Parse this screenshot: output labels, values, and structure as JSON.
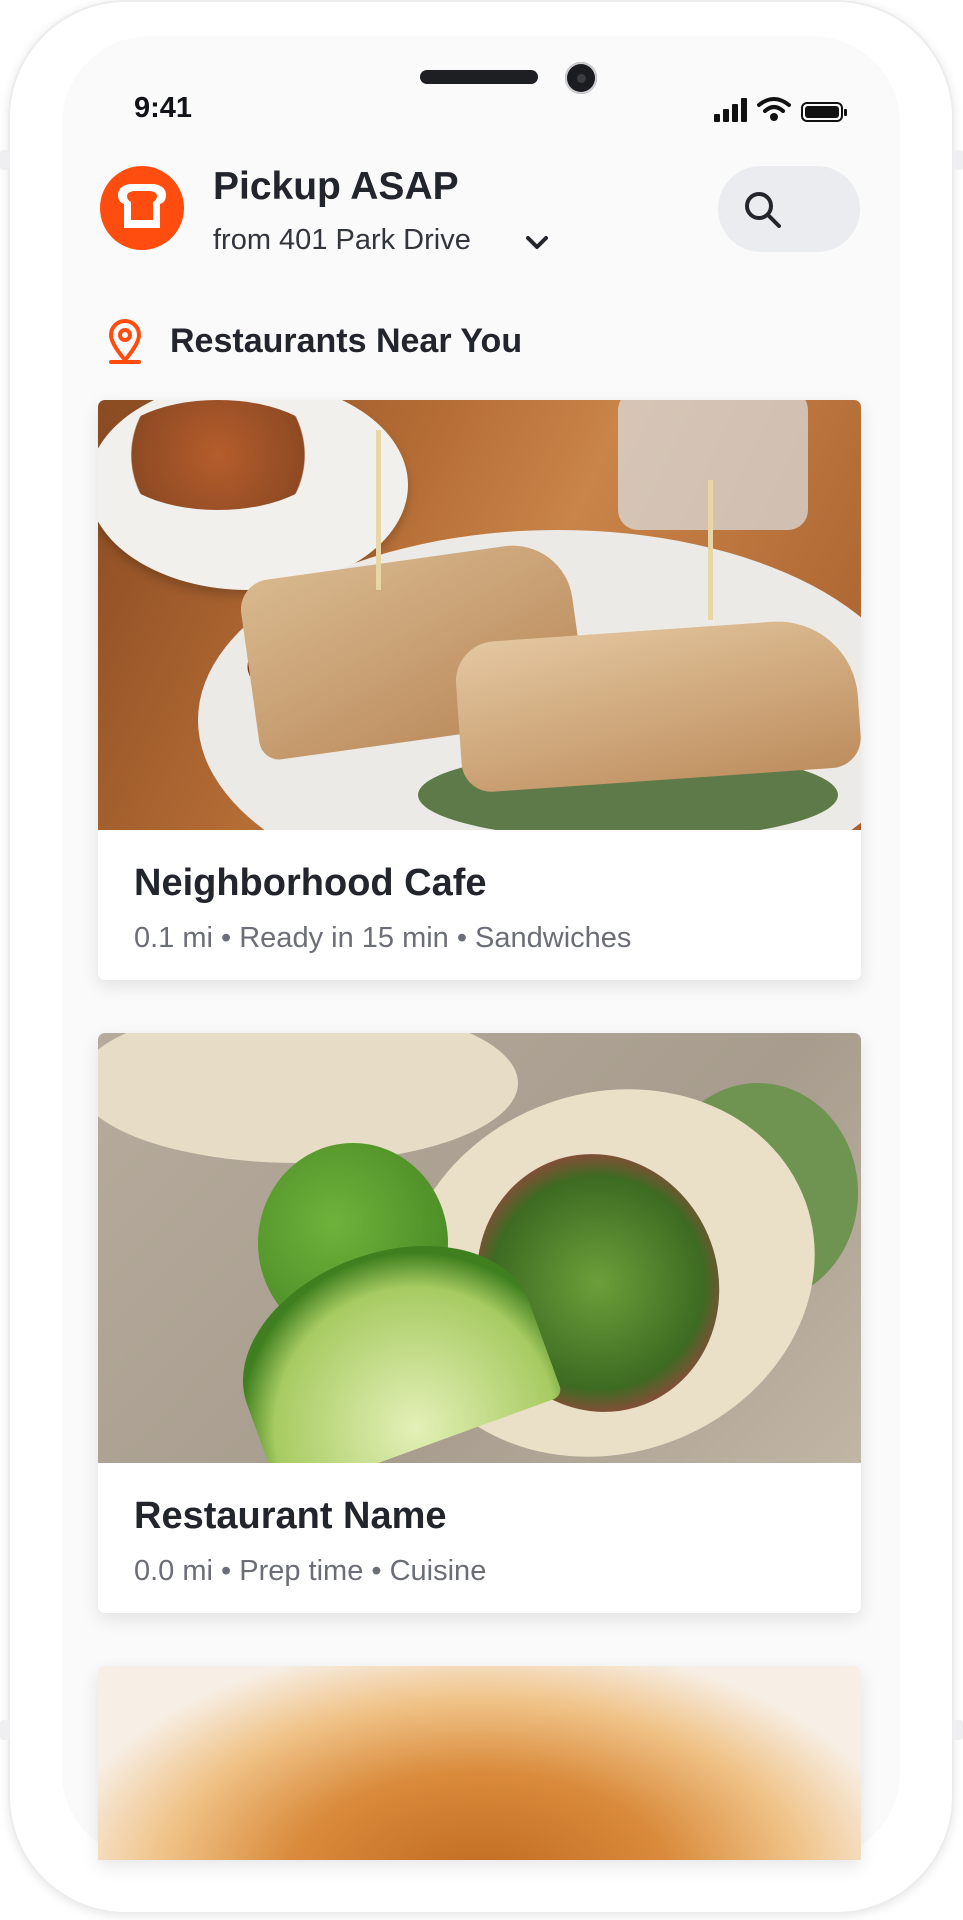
{
  "status_bar": {
    "time": "9:41"
  },
  "header": {
    "title": "Pickup ASAP",
    "from_location": "from 401 Park Drive"
  },
  "section": {
    "title": "Restaurants Near You"
  },
  "restaurants": [
    {
      "name": "Neighborhood Cafe",
      "meta": "0.1 mi • Ready in 15 min • Sandwiches"
    },
    {
      "name": "Restaurant Name",
      "meta": "0.0 mi • Prep time • Cuisine"
    }
  ],
  "colors": {
    "brand": "#ff4c0f",
    "text": "#23252d",
    "muted": "#6b6e76",
    "search_bg": "#ebecef"
  }
}
